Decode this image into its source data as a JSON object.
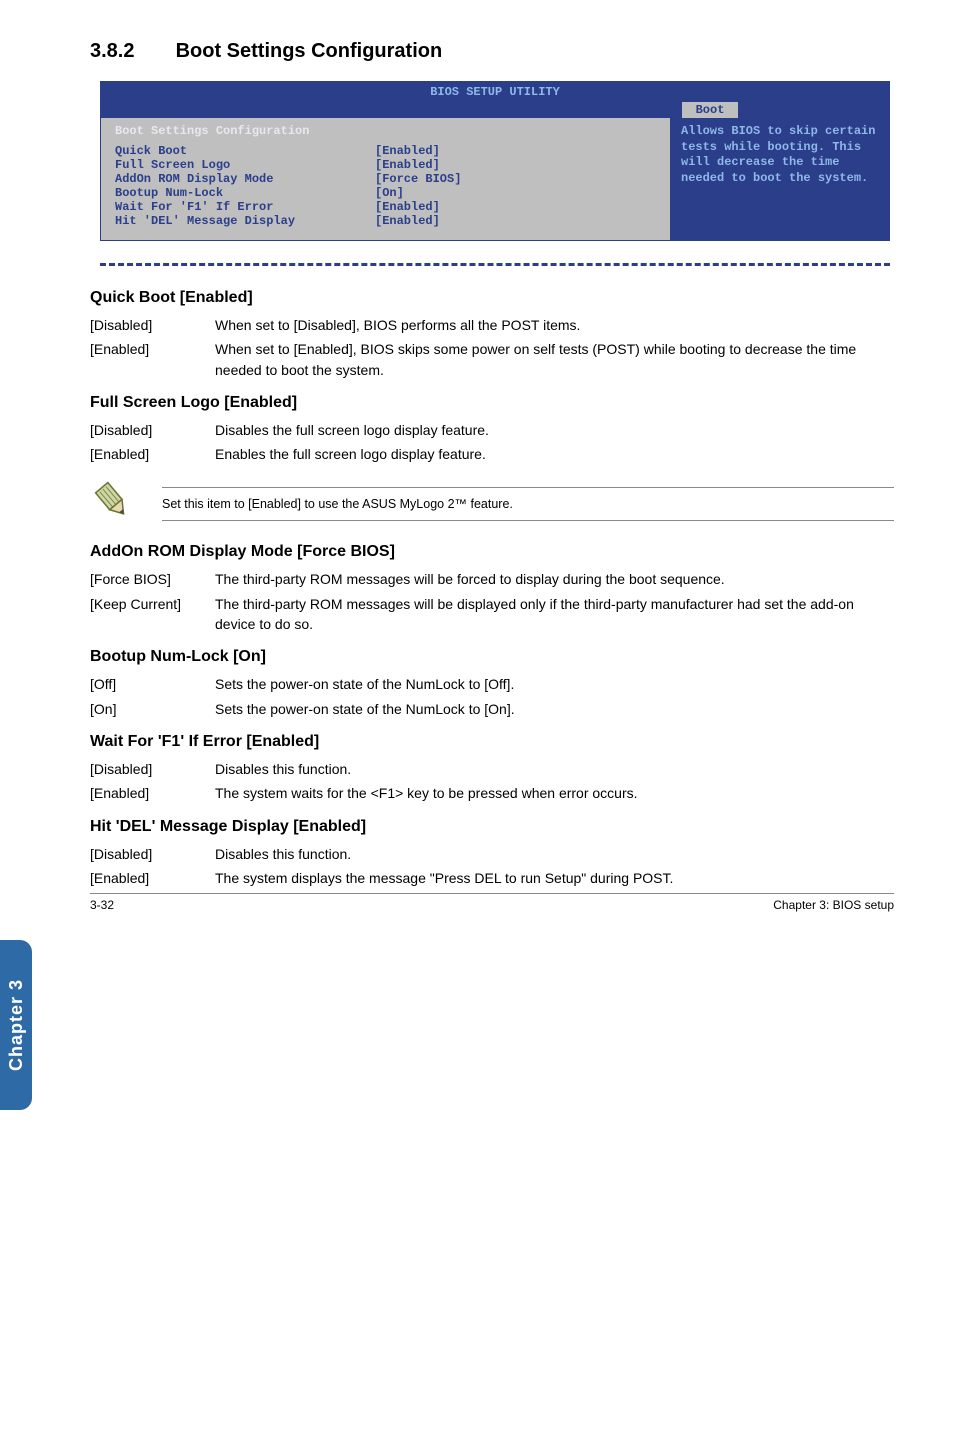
{
  "heading": {
    "number": "3.8.2",
    "title": "Boot Settings Configuration"
  },
  "bios": {
    "title": "BIOS SETUP UTILITY",
    "tab": "Boot",
    "subheader": "Boot Settings Configuration",
    "rows": [
      {
        "label": "Quick Boot",
        "value": "[Enabled]"
      },
      {
        "label": "Full Screen Logo",
        "value": "[Enabled]"
      },
      {
        "label": "AddOn ROM Display Mode",
        "value": "[Force BIOS]"
      },
      {
        "label": "Bootup Num-Lock",
        "value": "[On]"
      },
      {
        "label": "Wait For 'F1' If Error",
        "value": "[Enabled]"
      },
      {
        "label": "Hit 'DEL' Message Display",
        "value": "[Enabled]"
      }
    ],
    "help": "Allows BIOS to skip certain tests while booting. This will decrease the time needed to boot the system."
  },
  "sections": [
    {
      "title": "Quick Boot [Enabled]",
      "items": [
        {
          "key": "[Disabled]",
          "val": "When set to [Disabled], BIOS performs all the POST items."
        },
        {
          "key": "[Enabled]",
          "val": "When set to [Enabled], BIOS skips some power on self tests (POST) while booting to decrease the time needed to boot the system."
        }
      ]
    },
    {
      "title": "Full Screen Logo [Enabled]",
      "items": [
        {
          "key": "[Disabled]",
          "val": "Disables the full screen logo display feature."
        },
        {
          "key": "[Enabled]",
          "val": "Enables the full screen logo display feature."
        }
      ]
    }
  ],
  "note": "Set this item to [Enabled] to use the ASUS MyLogo 2™ feature.",
  "sections2": [
    {
      "title": "AddOn ROM Display Mode [Force BIOS]",
      "items": [
        {
          "key": "[Force BIOS]",
          "val": "The third-party ROM messages will be forced to display during the boot sequence."
        },
        {
          "key": "[Keep Current]",
          "val": "The third-party ROM messages will be displayed only if the third-party manufacturer had set the add-on device to do so."
        }
      ]
    },
    {
      "title": "Bootup Num-Lock [On]",
      "items": [
        {
          "key": "[Off]",
          "val": "Sets the power-on state of the NumLock to [Off]."
        },
        {
          "key": "[On]",
          "val": "Sets the power-on state of the NumLock to [On]."
        }
      ]
    },
    {
      "title": "Wait For 'F1' If Error [Enabled]",
      "items": [
        {
          "key": "[Disabled]",
          "val": "Disables this function."
        },
        {
          "key": "[Enabled]",
          "val": "The system waits for the <F1> key to be pressed when error occurs."
        }
      ]
    },
    {
      "title": "Hit 'DEL' Message Display [Enabled]",
      "items": [
        {
          "key": "[Disabled]",
          "val": "Disables this function."
        },
        {
          "key": "[Enabled]",
          "val": "The system displays the message \"Press DEL to run Setup\" during POST."
        }
      ]
    }
  ],
  "sidetab": "Chapter 3",
  "footer": {
    "left": "3-32",
    "right": "Chapter 3: BIOS setup"
  }
}
